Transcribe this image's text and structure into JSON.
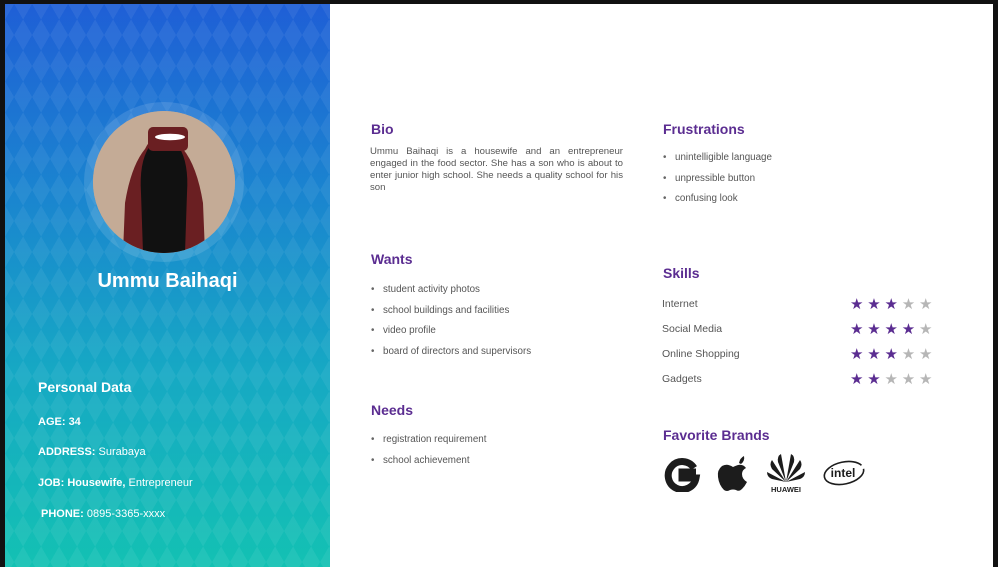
{
  "profile": {
    "name": "Ummu Baihaqi"
  },
  "personal_data": {
    "title": "Personal Data",
    "age_label": "AGE:",
    "age": "34",
    "address_label": "ADDRESS:",
    "address": "Surabaya",
    "job_label": "JOB:",
    "job_bold": "Housewife,",
    "job_rest": "Entrepreneur",
    "phone_label": "PHONE:",
    "phone": "0895-3365-xxxx"
  },
  "bio": {
    "title": "Bio",
    "text": "Ummu Baihaqi is a housewife and an entrepreneur engaged in the food sector. She has a son who is about to enter junior high school. She needs a quality school for his son"
  },
  "wants": {
    "title": "Wants",
    "items": [
      "student activity photos",
      "school buildings and facilities",
      "video profile",
      "board of directors and supervisors"
    ]
  },
  "needs": {
    "title": "Needs",
    "items": [
      "registration requirement",
      "school achievement"
    ]
  },
  "frustrations": {
    "title": "Frustrations",
    "items": [
      "unintelligible language",
      "unpressible button",
      "confusing look"
    ]
  },
  "skills": {
    "title": "Skills",
    "max_rating": 5,
    "items": [
      {
        "label": "Internet",
        "rating": 3
      },
      {
        "label": "Social Media",
        "rating": 4
      },
      {
        "label": "Online Shopping",
        "rating": 3
      },
      {
        "label": "Gadgets",
        "rating": 2
      }
    ]
  },
  "brands": {
    "title": "Favorite Brands",
    "items": [
      "google-icon",
      "apple-icon",
      "huawei-icon",
      "intel-icon"
    ],
    "huawei_text": "HUAWEI",
    "intel_text": "intel"
  },
  "colors": {
    "accent": "#5b2d91",
    "sidebar_top": "#1f5fd6",
    "sidebar_bottom": "#13c1b3",
    "star_off": "#b6b6b6"
  }
}
